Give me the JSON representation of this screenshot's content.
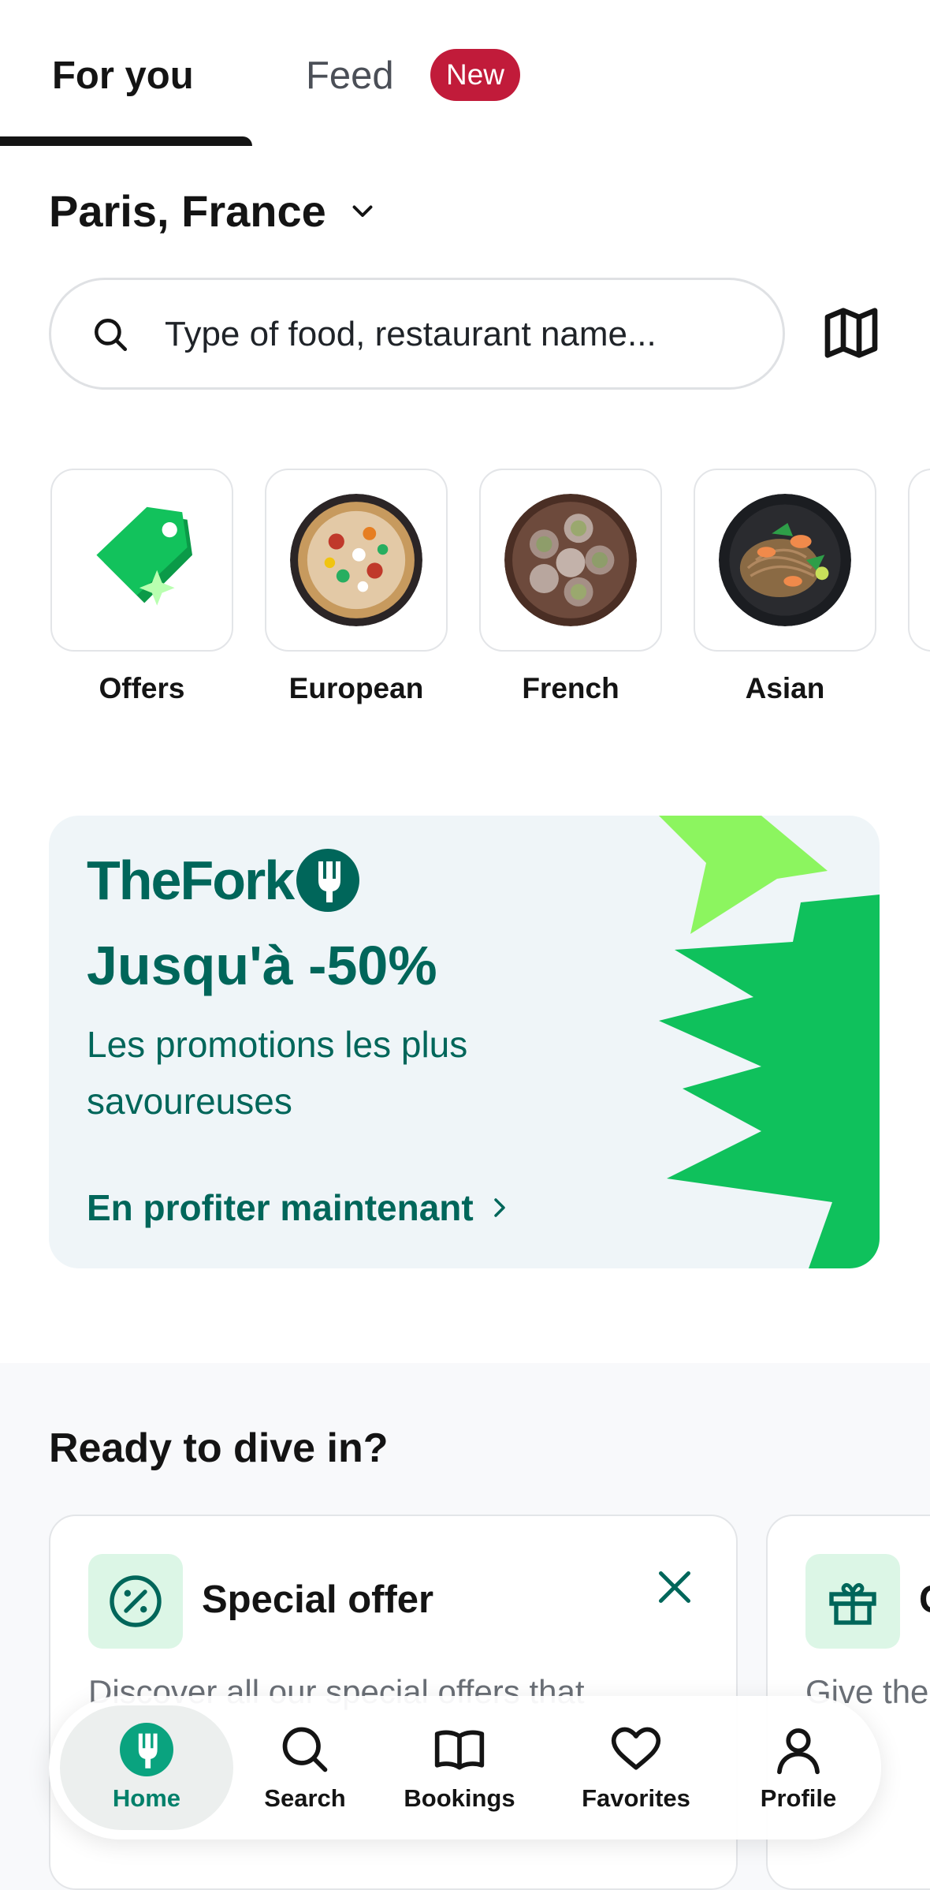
{
  "tabs": {
    "for_you": "For you",
    "feed": "Feed",
    "feed_badge": "New"
  },
  "location": {
    "city": "Paris, France"
  },
  "search": {
    "placeholder": "Type of food, restaurant name..."
  },
  "categories": [
    {
      "label": "Offers",
      "icon": "tag-icon"
    },
    {
      "label": "European",
      "icon": "pizza-image"
    },
    {
      "label": "French",
      "icon": "escargot-image"
    },
    {
      "label": "Asian",
      "icon": "noodles-image"
    }
  ],
  "promo": {
    "brand": "TheFork",
    "headline": "Jusqu'à -50%",
    "subtitle": "Les promotions les plus savoureuses",
    "cta": "En profiter maintenant"
  },
  "ready": {
    "title": "Ready to dive in?",
    "cards": [
      {
        "title": "Special offer",
        "description": "Discover all our special offers that",
        "icon": "percent-badge-icon"
      },
      {
        "title": "G",
        "description": "Give the",
        "icon": "gift-icon"
      }
    ]
  },
  "nav": {
    "home": "Home",
    "search": "Search",
    "bookings": "Bookings",
    "favorites": "Favorites",
    "profile": "Profile"
  },
  "colors": {
    "brand_green": "#00665a",
    "accent_green": "#0dbf5f",
    "badge_red": "#c11b3a",
    "promo_bg": "#eff5f8"
  }
}
